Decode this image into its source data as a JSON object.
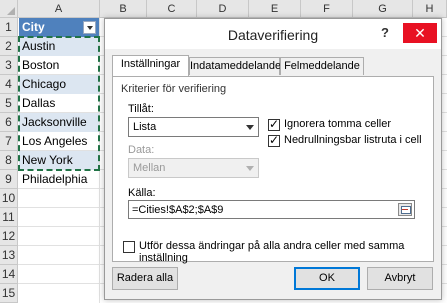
{
  "spreadsheet": {
    "columns": [
      "A",
      "B",
      "C",
      "D",
      "E",
      "F",
      "G",
      "H"
    ],
    "rows": [
      "1",
      "2",
      "3",
      "4",
      "5",
      "6",
      "7",
      "8",
      "9",
      "10",
      "11",
      "12",
      "13",
      "14",
      "15"
    ],
    "header_cell": "City",
    "cities": [
      "Austin",
      "Boston",
      "Chicago",
      "Dallas",
      "Jacksonville",
      "Los Angeles",
      "New York",
      "Philadelphia"
    ],
    "table_header_color": "#4f81bd",
    "band_color": "#dce6f1",
    "copy_border_color": "#217346"
  },
  "dialog": {
    "title": "Dataverifiering",
    "help": "?",
    "close": "✕",
    "tabs": [
      "Inställningar",
      "Indatameddelande",
      "Felmeddelande"
    ],
    "active_tab": "Inställningar",
    "group_title": "Kriterier för verifiering",
    "allow_label": "Tillåt:",
    "allow_value": "Lista",
    "ignore_blank_label": "Ignorera tomma celler",
    "ignore_blank_checked": true,
    "dropdown_label": "Nedrullningsbar listruta i cell",
    "dropdown_checked": true,
    "data_label": "Data:",
    "data_value": "Mellan",
    "source_label": "Källa:",
    "source_value": "=Cities!$A$2;$A$9",
    "apply_all_label": "Utför dessa ändringar på alla andra celler med samma inställning",
    "apply_all_checked": false,
    "clear_all": "Radera alla",
    "ok": "OK",
    "cancel": "Avbryt"
  }
}
